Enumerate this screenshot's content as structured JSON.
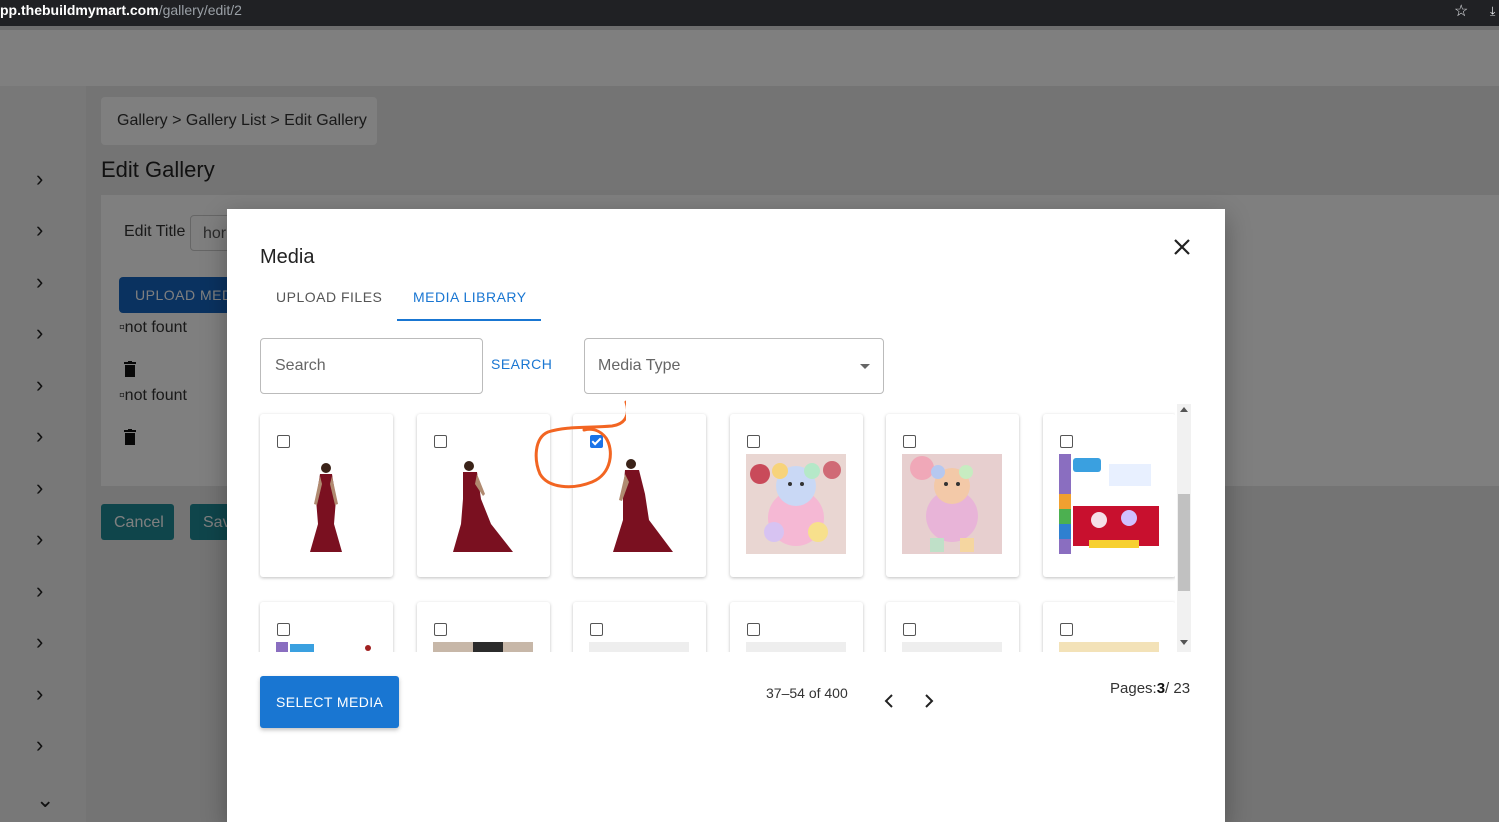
{
  "browser": {
    "host": "pp.thebuildmymart.com",
    "path": "/gallery/edit/2"
  },
  "breadcrumb": "Gallery > Gallery List > Edit Gallery",
  "page": {
    "title": "Edit Gallery",
    "edit_title_label": "Edit Title",
    "edit_title_value": "hor",
    "upload_label": "UPLOAD MEDIA",
    "broken_image_text_1": "not fount",
    "broken_image_text_2": "not fount",
    "cancel_label": "Cancel",
    "save_label": "Save"
  },
  "modal": {
    "title": "Media",
    "tabs": [
      {
        "label": "UPLOAD FILES",
        "active": false
      },
      {
        "label": "MEDIA LIBRARY",
        "active": true
      }
    ],
    "search_placeholder": "Search",
    "search_button": "SEARCH",
    "media_type_placeholder": "Media Type",
    "select_button": "SELECT MEDIA",
    "range_text": "37–54 of 400",
    "pages_label": "Pages:",
    "current_page": "3",
    "total_pages": "/ 23",
    "items": [
      {
        "kind": "saree",
        "checked": false
      },
      {
        "kind": "saree",
        "checked": false
      },
      {
        "kind": "saree",
        "checked": true
      },
      {
        "kind": "teddy",
        "checked": false
      },
      {
        "kind": "teddy",
        "checked": false
      },
      {
        "kind": "book",
        "checked": false
      },
      {
        "kind": "book",
        "checked": false
      },
      {
        "kind": "photo",
        "checked": false
      },
      {
        "kind": "blank",
        "checked": false
      },
      {
        "kind": "blank",
        "checked": false
      },
      {
        "kind": "blank",
        "checked": false
      },
      {
        "kind": "photo",
        "checked": false
      }
    ]
  },
  "colors": {
    "accent": "#1976d2",
    "annotation": "#f26522",
    "button_teal": "#1e8a96"
  }
}
